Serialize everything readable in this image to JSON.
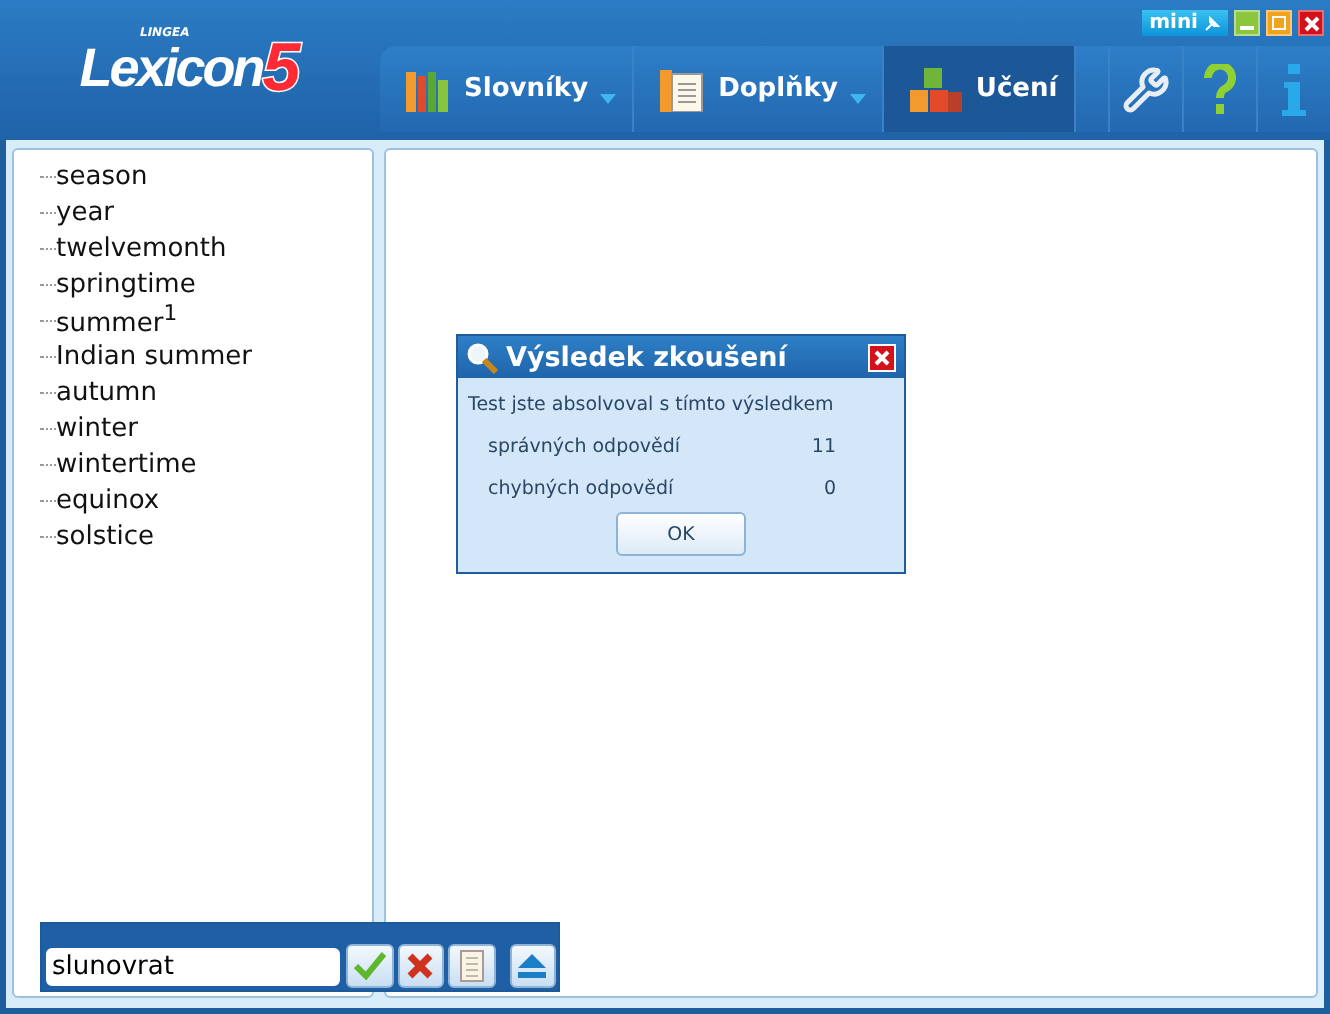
{
  "logo": {
    "brand": "LINGEA",
    "name": "Lexicon",
    "version": "5"
  },
  "window_controls": {
    "mini": "mini"
  },
  "tabs": [
    {
      "label": "Slovníky",
      "kind": "books",
      "dropdown": true,
      "selected": false
    },
    {
      "label": "Doplňky",
      "kind": "document",
      "dropdown": true,
      "selected": false
    },
    {
      "label": "Učení",
      "kind": "blocks",
      "dropdown": false,
      "selected": true
    }
  ],
  "word_list": [
    "season",
    "year",
    "twelvemonth",
    "springtime",
    "summer$^{1}$",
    "Indian summer",
    "autumn",
    "winter",
    "wintertime",
    "equinox",
    "solstice"
  ],
  "dialog": {
    "title": "Výsledek zkoušení",
    "message": "Test jste absolvoval s tímto výsledkem",
    "rows": [
      {
        "label": "správných odpovědí",
        "value": "11"
      },
      {
        "label": "chybných odpovědí",
        "value": "0"
      }
    ],
    "button": "OK"
  },
  "answer_bar": {
    "value": "slunovrat"
  }
}
